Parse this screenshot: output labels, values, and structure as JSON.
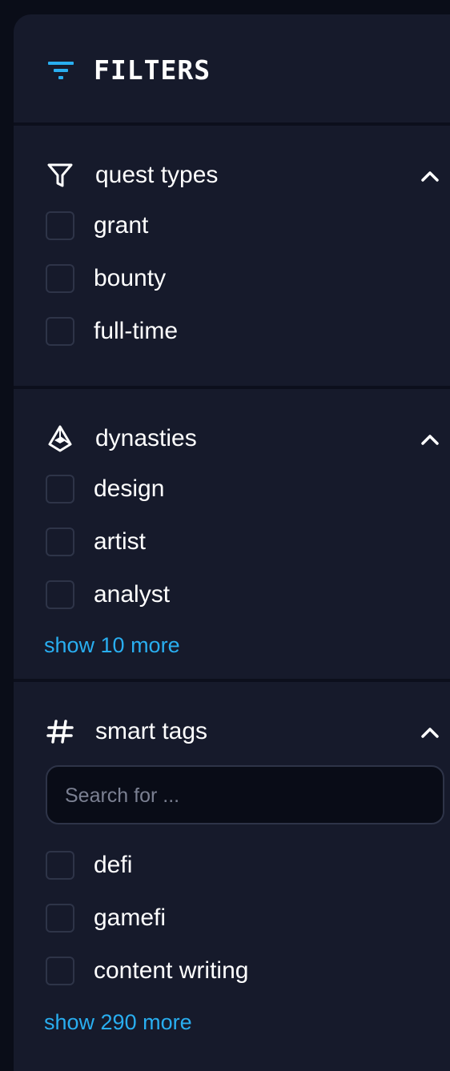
{
  "header": {
    "title": "FILTERS",
    "icon": "filter-lines-icon"
  },
  "colors": {
    "panel_bg": "#161a2b",
    "page_bg": "#0a0d18",
    "accent": "#29aef0",
    "divider": "#0c0f1c",
    "checkbox_border": "#2e3448"
  },
  "sections": {
    "quest_types": {
      "title": "quest types",
      "icon": "funnel-icon",
      "options": [
        "grant",
        "bounty",
        "full-time"
      ]
    },
    "dynasties": {
      "title": "dynasties",
      "icon": "dynasty-icon",
      "options": [
        "design",
        "artist",
        "analyst"
      ],
      "show_more": "show 10 more"
    },
    "smart_tags": {
      "title": "smart tags",
      "icon": "hashtag-icon",
      "search_placeholder": "Search for ...",
      "options": [
        "defi",
        "gamefi",
        "content writing"
      ],
      "show_more": "show 290 more"
    }
  }
}
